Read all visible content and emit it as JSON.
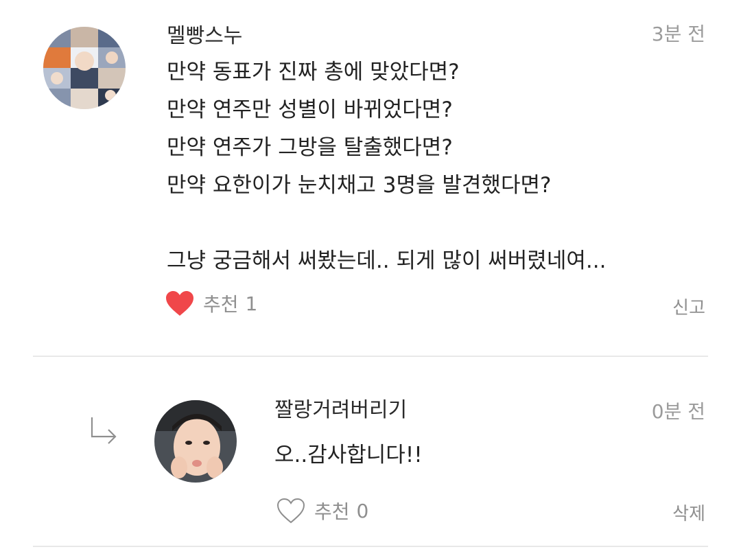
{
  "comments": [
    {
      "author": "멜빵스누",
      "time": "3분 전",
      "lines": [
        "만약 동표가 진짜 총에 맞았다면?",
        "만약 연주만 성별이 바뀌었다면?",
        "만약 연주가 그방을 탈출했다면?",
        "만약 요한이가 눈치채고 3명을 발견했다면?",
        "",
        "그냥 궁금해서 써봤는데.. 되게 많이 써버렸네여..."
      ],
      "like_label": "추천",
      "like_count": "1",
      "liked": true,
      "action": "신고"
    },
    {
      "author": "짤랑거려버리기",
      "time": "0분 전",
      "lines": [
        "오..감사합니다!!"
      ],
      "like_label": "추천",
      "like_count": "0",
      "liked": false,
      "action": "삭제"
    }
  ],
  "icons": {
    "heart_filled": "heart-filled-icon",
    "heart_outline": "heart-outline-icon",
    "reply_arrow": "reply-arrow-icon"
  },
  "colors": {
    "heart": "#f0474a",
    "muted_text": "#9b9b9b",
    "divider": "#e8e8e8"
  }
}
